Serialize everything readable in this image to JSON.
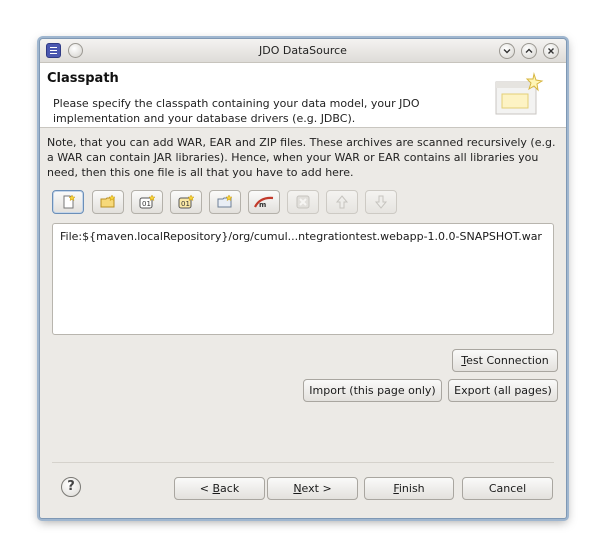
{
  "window": {
    "title": "JDO DataSource",
    "controls": [
      "minimize",
      "maximize",
      "close"
    ]
  },
  "header": {
    "title": "Classpath",
    "description": "Please specify the classpath containing your data model, your JDO implementation and your database drivers (e.g. JDBC)."
  },
  "note": "Note, that you can add WAR, EAR and ZIP files. These archives are scanned recursively (e.g. a WAR can contain JAR libraries). Hence, when your WAR or EAR contains all libraries you need, then this one file is all that you have to add here.",
  "toolbar": {
    "buttons": [
      {
        "name": "add-file-icon",
        "enabled": true
      },
      {
        "name": "add-folder-icon",
        "enabled": true
      },
      {
        "name": "add-workspace-jar-icon",
        "enabled": true
      },
      {
        "name": "add-external-jar-icon",
        "enabled": true
      },
      {
        "name": "add-variable-icon",
        "enabled": true
      },
      {
        "name": "add-maven-icon",
        "enabled": true
      },
      {
        "name": "remove-icon",
        "enabled": false
      },
      {
        "name": "move-up-icon",
        "enabled": false
      },
      {
        "name": "move-down-icon",
        "enabled": false
      }
    ]
  },
  "classpath": {
    "items": [
      "File:${maven.localRepository}/org/cumul...ntegrationtest.webapp-1.0.0-SNAPSHOT.war"
    ]
  },
  "actions": {
    "test_connection_pre": "",
    "test_connection_mnemonic": "T",
    "test_connection_post": "est Connection",
    "import": "Import (this page only)",
    "export": "Export (all pages)"
  },
  "footer": {
    "back_pre": "< ",
    "back_mnemonic": "B",
    "back_post": "ack",
    "next_mnemonic": "N",
    "next_post": "ext >",
    "finish_mnemonic": "F",
    "finish_post": "inish",
    "cancel": "Cancel"
  },
  "colors": {
    "window_bg": "#eceae6",
    "border_accent": "#7f98b4",
    "header_bg": "#ffffff"
  }
}
